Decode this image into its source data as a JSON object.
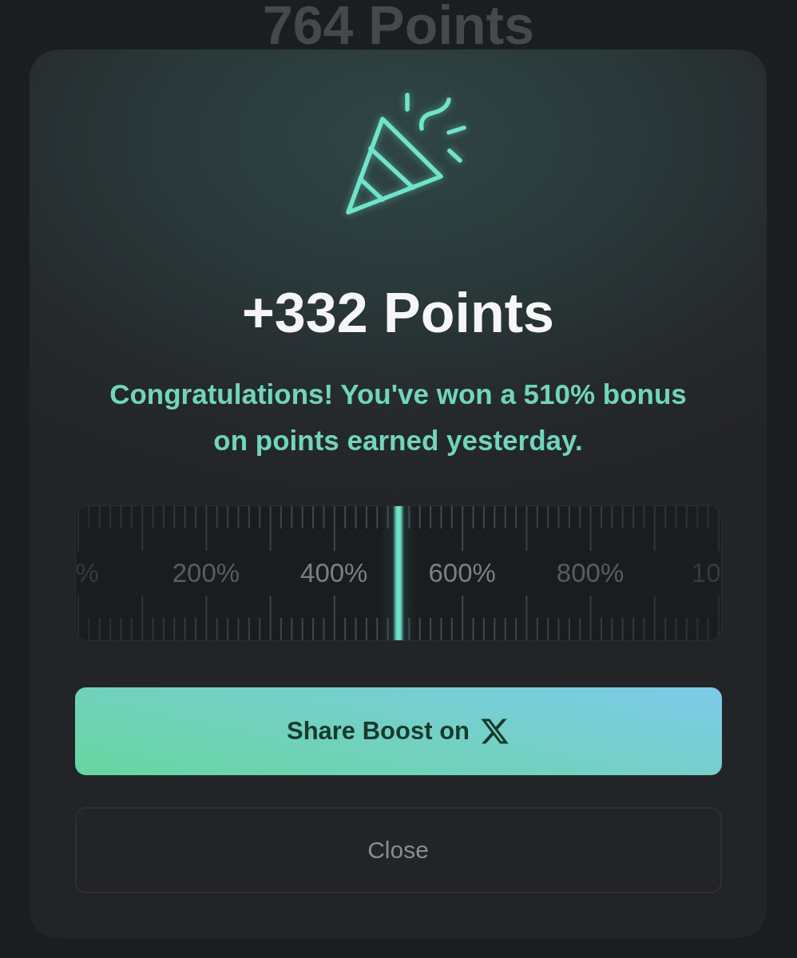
{
  "background": {
    "title": "764 Points"
  },
  "dialog": {
    "title": "+332 Points",
    "message": "Congratulations! You've won a 510% bonus on points earned yesterday.",
    "ruler": {
      "labels": [
        "%",
        "200%",
        "400%",
        "600%",
        "800%",
        "10"
      ],
      "level": 0.5
    },
    "buttons": [
      {
        "kind": "share",
        "label": "Share Boost on"
      },
      {
        "kind": "close",
        "label": "Close"
      }
    ]
  }
}
